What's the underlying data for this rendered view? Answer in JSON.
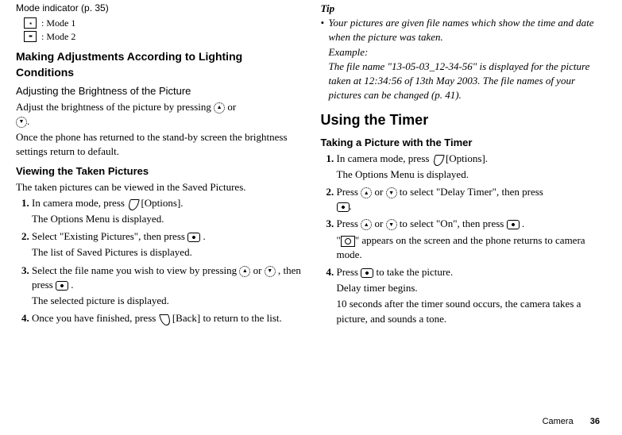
{
  "left": {
    "mode_indicator": "Mode indicator (p. 35)",
    "mode1_suffix": ": Mode 1",
    "mode2_suffix": ": Mode 2",
    "making_adjust_h": "Making Adjustments According to Lighting Conditions",
    "adjust_bright_h": "Adjusting the Brightness of the Picture",
    "adjust_bright_p1_a": "Adjust the brightness of the picture by pressing ",
    "adjust_bright_p1_b": " or ",
    "adjust_bright_p1_c": ".",
    "adjust_bright_p2": "Once the phone has returned to the stand-by screen the brightness settings return to default.",
    "viewing_h": "Viewing the Taken Pictures",
    "viewing_p": "The taken pictures can be viewed in the Saved Pictures.",
    "s1a": "In camera mode, press ",
    "s1b": " [Options].",
    "s1sub": "The Options Menu is displayed.",
    "s2a": "Select \"Existing Pictures\", then press ",
    "s2b": ".",
    "s2sub": "The list of Saved Pictures is displayed.",
    "s3a": "Select the file name you wish to view by pressing ",
    "s3b": " or ",
    "s3c": ", then press ",
    "s3d": ".",
    "s3sub": "The selected picture is displayed.",
    "s4a": "Once you have finished, press ",
    "s4b": " [Back] to return to the list."
  },
  "right": {
    "tip_h": "Tip",
    "tip_bullet": "•",
    "tip_body": "Your pictures are given file names which show the time and date when the picture was taken.\nExample:\nThe file name \"13-05-03_12-34-56\" is displayed for the picture taken at 12:34:56 of 13th May 2003. The file names of your pictures can be changed (p. 41).",
    "using_timer_h": "Using the Timer",
    "taking_h": "Taking a Picture with the Timer",
    "t1a": "In camera mode, press ",
    "t1b": " [Options].",
    "t1sub": "The Options Menu is displayed.",
    "t2a": "Press ",
    "t2b": " or ",
    "t2c": " to select \"Delay Timer\", then press ",
    "t2d": ".",
    "t3a": "Press ",
    "t3b": " or ",
    "t3c": " to select \"On\", then press ",
    "t3d": ".",
    "t3suba": "\"",
    "t3subb": "\" appears on the screen and the phone returns to camera mode.",
    "t4a": "Press ",
    "t4b": " to take the picture.",
    "t4sub1": "Delay timer begins.",
    "t4sub2": "10 seconds after the timer sound occurs, the camera takes a picture, and sounds a tone."
  },
  "footer": {
    "section": "Camera",
    "page": "36"
  }
}
